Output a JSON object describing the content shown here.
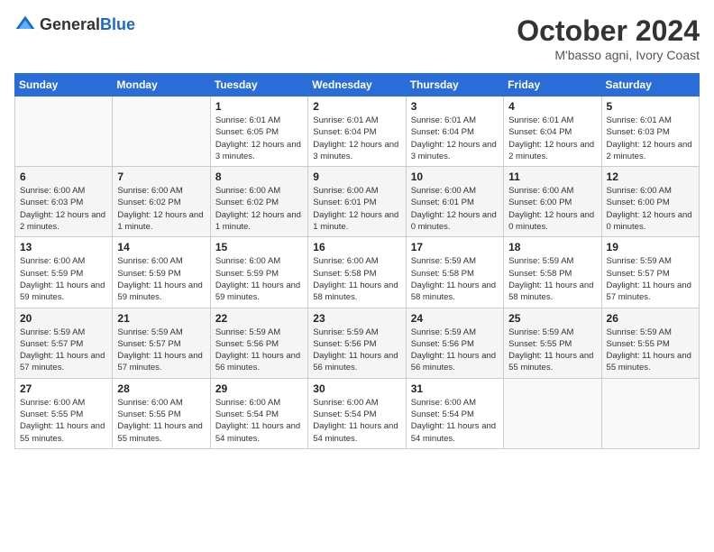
{
  "header": {
    "logo_general": "General",
    "logo_blue": "Blue",
    "month": "October 2024",
    "location": "M'basso agni, Ivory Coast"
  },
  "days_of_week": [
    "Sunday",
    "Monday",
    "Tuesday",
    "Wednesday",
    "Thursday",
    "Friday",
    "Saturday"
  ],
  "weeks": [
    [
      {
        "day": "",
        "sunrise": "",
        "sunset": "",
        "daylight": ""
      },
      {
        "day": "",
        "sunrise": "",
        "sunset": "",
        "daylight": ""
      },
      {
        "day": "1",
        "sunrise": "Sunrise: 6:01 AM",
        "sunset": "Sunset: 6:05 PM",
        "daylight": "Daylight: 12 hours and 3 minutes."
      },
      {
        "day": "2",
        "sunrise": "Sunrise: 6:01 AM",
        "sunset": "Sunset: 6:04 PM",
        "daylight": "Daylight: 12 hours and 3 minutes."
      },
      {
        "day": "3",
        "sunrise": "Sunrise: 6:01 AM",
        "sunset": "Sunset: 6:04 PM",
        "daylight": "Daylight: 12 hours and 3 minutes."
      },
      {
        "day": "4",
        "sunrise": "Sunrise: 6:01 AM",
        "sunset": "Sunset: 6:04 PM",
        "daylight": "Daylight: 12 hours and 2 minutes."
      },
      {
        "day": "5",
        "sunrise": "Sunrise: 6:01 AM",
        "sunset": "Sunset: 6:03 PM",
        "daylight": "Daylight: 12 hours and 2 minutes."
      }
    ],
    [
      {
        "day": "6",
        "sunrise": "Sunrise: 6:00 AM",
        "sunset": "Sunset: 6:03 PM",
        "daylight": "Daylight: 12 hours and 2 minutes."
      },
      {
        "day": "7",
        "sunrise": "Sunrise: 6:00 AM",
        "sunset": "Sunset: 6:02 PM",
        "daylight": "Daylight: 12 hours and 1 minute."
      },
      {
        "day": "8",
        "sunrise": "Sunrise: 6:00 AM",
        "sunset": "Sunset: 6:02 PM",
        "daylight": "Daylight: 12 hours and 1 minute."
      },
      {
        "day": "9",
        "sunrise": "Sunrise: 6:00 AM",
        "sunset": "Sunset: 6:01 PM",
        "daylight": "Daylight: 12 hours and 1 minute."
      },
      {
        "day": "10",
        "sunrise": "Sunrise: 6:00 AM",
        "sunset": "Sunset: 6:01 PM",
        "daylight": "Daylight: 12 hours and 0 minutes."
      },
      {
        "day": "11",
        "sunrise": "Sunrise: 6:00 AM",
        "sunset": "Sunset: 6:00 PM",
        "daylight": "Daylight: 12 hours and 0 minutes."
      },
      {
        "day": "12",
        "sunrise": "Sunrise: 6:00 AM",
        "sunset": "Sunset: 6:00 PM",
        "daylight": "Daylight: 12 hours and 0 minutes."
      }
    ],
    [
      {
        "day": "13",
        "sunrise": "Sunrise: 6:00 AM",
        "sunset": "Sunset: 5:59 PM",
        "daylight": "Daylight: 11 hours and 59 minutes."
      },
      {
        "day": "14",
        "sunrise": "Sunrise: 6:00 AM",
        "sunset": "Sunset: 5:59 PM",
        "daylight": "Daylight: 11 hours and 59 minutes."
      },
      {
        "day": "15",
        "sunrise": "Sunrise: 6:00 AM",
        "sunset": "Sunset: 5:59 PM",
        "daylight": "Daylight: 11 hours and 59 minutes."
      },
      {
        "day": "16",
        "sunrise": "Sunrise: 6:00 AM",
        "sunset": "Sunset: 5:58 PM",
        "daylight": "Daylight: 11 hours and 58 minutes."
      },
      {
        "day": "17",
        "sunrise": "Sunrise: 5:59 AM",
        "sunset": "Sunset: 5:58 PM",
        "daylight": "Daylight: 11 hours and 58 minutes."
      },
      {
        "day": "18",
        "sunrise": "Sunrise: 5:59 AM",
        "sunset": "Sunset: 5:58 PM",
        "daylight": "Daylight: 11 hours and 58 minutes."
      },
      {
        "day": "19",
        "sunrise": "Sunrise: 5:59 AM",
        "sunset": "Sunset: 5:57 PM",
        "daylight": "Daylight: 11 hours and 57 minutes."
      }
    ],
    [
      {
        "day": "20",
        "sunrise": "Sunrise: 5:59 AM",
        "sunset": "Sunset: 5:57 PM",
        "daylight": "Daylight: 11 hours and 57 minutes."
      },
      {
        "day": "21",
        "sunrise": "Sunrise: 5:59 AM",
        "sunset": "Sunset: 5:57 PM",
        "daylight": "Daylight: 11 hours and 57 minutes."
      },
      {
        "day": "22",
        "sunrise": "Sunrise: 5:59 AM",
        "sunset": "Sunset: 5:56 PM",
        "daylight": "Daylight: 11 hours and 56 minutes."
      },
      {
        "day": "23",
        "sunrise": "Sunrise: 5:59 AM",
        "sunset": "Sunset: 5:56 PM",
        "daylight": "Daylight: 11 hours and 56 minutes."
      },
      {
        "day": "24",
        "sunrise": "Sunrise: 5:59 AM",
        "sunset": "Sunset: 5:56 PM",
        "daylight": "Daylight: 11 hours and 56 minutes."
      },
      {
        "day": "25",
        "sunrise": "Sunrise: 5:59 AM",
        "sunset": "Sunset: 5:55 PM",
        "daylight": "Daylight: 11 hours and 55 minutes."
      },
      {
        "day": "26",
        "sunrise": "Sunrise: 5:59 AM",
        "sunset": "Sunset: 5:55 PM",
        "daylight": "Daylight: 11 hours and 55 minutes."
      }
    ],
    [
      {
        "day": "27",
        "sunrise": "Sunrise: 6:00 AM",
        "sunset": "Sunset: 5:55 PM",
        "daylight": "Daylight: 11 hours and 55 minutes."
      },
      {
        "day": "28",
        "sunrise": "Sunrise: 6:00 AM",
        "sunset": "Sunset: 5:55 PM",
        "daylight": "Daylight: 11 hours and 55 minutes."
      },
      {
        "day": "29",
        "sunrise": "Sunrise: 6:00 AM",
        "sunset": "Sunset: 5:54 PM",
        "daylight": "Daylight: 11 hours and 54 minutes."
      },
      {
        "day": "30",
        "sunrise": "Sunrise: 6:00 AM",
        "sunset": "Sunset: 5:54 PM",
        "daylight": "Daylight: 11 hours and 54 minutes."
      },
      {
        "day": "31",
        "sunrise": "Sunrise: 6:00 AM",
        "sunset": "Sunset: 5:54 PM",
        "daylight": "Daylight: 11 hours and 54 minutes."
      },
      {
        "day": "",
        "sunrise": "",
        "sunset": "",
        "daylight": ""
      },
      {
        "day": "",
        "sunrise": "",
        "sunset": "",
        "daylight": ""
      }
    ]
  ]
}
